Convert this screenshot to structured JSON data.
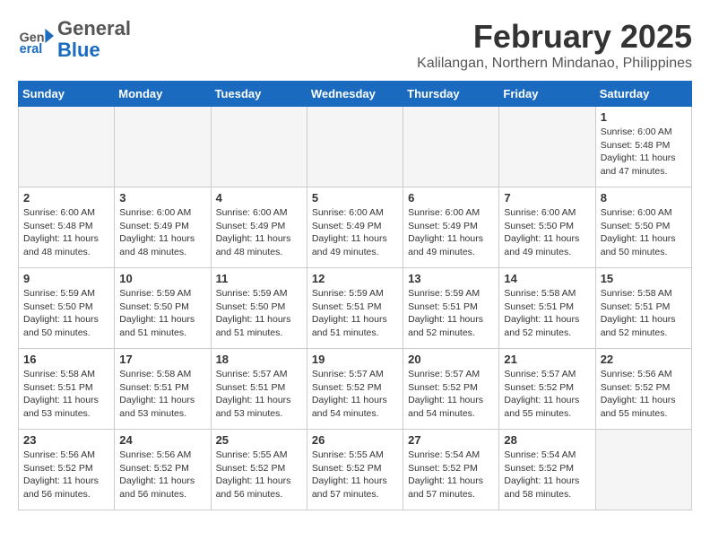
{
  "header": {
    "logo_general": "General",
    "logo_blue": "Blue",
    "month_title": "February 2025",
    "location": "Kalilangan, Northern Mindanao, Philippines"
  },
  "weekdays": [
    "Sunday",
    "Monday",
    "Tuesday",
    "Wednesday",
    "Thursday",
    "Friday",
    "Saturday"
  ],
  "weeks": [
    [
      {
        "day": "",
        "info": ""
      },
      {
        "day": "",
        "info": ""
      },
      {
        "day": "",
        "info": ""
      },
      {
        "day": "",
        "info": ""
      },
      {
        "day": "",
        "info": ""
      },
      {
        "day": "",
        "info": ""
      },
      {
        "day": "1",
        "info": "Sunrise: 6:00 AM\nSunset: 5:48 PM\nDaylight: 11 hours\nand 47 minutes."
      }
    ],
    [
      {
        "day": "2",
        "info": "Sunrise: 6:00 AM\nSunset: 5:48 PM\nDaylight: 11 hours\nand 48 minutes."
      },
      {
        "day": "3",
        "info": "Sunrise: 6:00 AM\nSunset: 5:49 PM\nDaylight: 11 hours\nand 48 minutes."
      },
      {
        "day": "4",
        "info": "Sunrise: 6:00 AM\nSunset: 5:49 PM\nDaylight: 11 hours\nand 48 minutes."
      },
      {
        "day": "5",
        "info": "Sunrise: 6:00 AM\nSunset: 5:49 PM\nDaylight: 11 hours\nand 49 minutes."
      },
      {
        "day": "6",
        "info": "Sunrise: 6:00 AM\nSunset: 5:49 PM\nDaylight: 11 hours\nand 49 minutes."
      },
      {
        "day": "7",
        "info": "Sunrise: 6:00 AM\nSunset: 5:50 PM\nDaylight: 11 hours\nand 49 minutes."
      },
      {
        "day": "8",
        "info": "Sunrise: 6:00 AM\nSunset: 5:50 PM\nDaylight: 11 hours\nand 50 minutes."
      }
    ],
    [
      {
        "day": "9",
        "info": "Sunrise: 5:59 AM\nSunset: 5:50 PM\nDaylight: 11 hours\nand 50 minutes."
      },
      {
        "day": "10",
        "info": "Sunrise: 5:59 AM\nSunset: 5:50 PM\nDaylight: 11 hours\nand 51 minutes."
      },
      {
        "day": "11",
        "info": "Sunrise: 5:59 AM\nSunset: 5:50 PM\nDaylight: 11 hours\nand 51 minutes."
      },
      {
        "day": "12",
        "info": "Sunrise: 5:59 AM\nSunset: 5:51 PM\nDaylight: 11 hours\nand 51 minutes."
      },
      {
        "day": "13",
        "info": "Sunrise: 5:59 AM\nSunset: 5:51 PM\nDaylight: 11 hours\nand 52 minutes."
      },
      {
        "day": "14",
        "info": "Sunrise: 5:58 AM\nSunset: 5:51 PM\nDaylight: 11 hours\nand 52 minutes."
      },
      {
        "day": "15",
        "info": "Sunrise: 5:58 AM\nSunset: 5:51 PM\nDaylight: 11 hours\nand 52 minutes."
      }
    ],
    [
      {
        "day": "16",
        "info": "Sunrise: 5:58 AM\nSunset: 5:51 PM\nDaylight: 11 hours\nand 53 minutes."
      },
      {
        "day": "17",
        "info": "Sunrise: 5:58 AM\nSunset: 5:51 PM\nDaylight: 11 hours\nand 53 minutes."
      },
      {
        "day": "18",
        "info": "Sunrise: 5:57 AM\nSunset: 5:51 PM\nDaylight: 11 hours\nand 53 minutes."
      },
      {
        "day": "19",
        "info": "Sunrise: 5:57 AM\nSunset: 5:52 PM\nDaylight: 11 hours\nand 54 minutes."
      },
      {
        "day": "20",
        "info": "Sunrise: 5:57 AM\nSunset: 5:52 PM\nDaylight: 11 hours\nand 54 minutes."
      },
      {
        "day": "21",
        "info": "Sunrise: 5:57 AM\nSunset: 5:52 PM\nDaylight: 11 hours\nand 55 minutes."
      },
      {
        "day": "22",
        "info": "Sunrise: 5:56 AM\nSunset: 5:52 PM\nDaylight: 11 hours\nand 55 minutes."
      }
    ],
    [
      {
        "day": "23",
        "info": "Sunrise: 5:56 AM\nSunset: 5:52 PM\nDaylight: 11 hours\nand 56 minutes."
      },
      {
        "day": "24",
        "info": "Sunrise: 5:56 AM\nSunset: 5:52 PM\nDaylight: 11 hours\nand 56 minutes."
      },
      {
        "day": "25",
        "info": "Sunrise: 5:55 AM\nSunset: 5:52 PM\nDaylight: 11 hours\nand 56 minutes."
      },
      {
        "day": "26",
        "info": "Sunrise: 5:55 AM\nSunset: 5:52 PM\nDaylight: 11 hours\nand 57 minutes."
      },
      {
        "day": "27",
        "info": "Sunrise: 5:54 AM\nSunset: 5:52 PM\nDaylight: 11 hours\nand 57 minutes."
      },
      {
        "day": "28",
        "info": "Sunrise: 5:54 AM\nSunset: 5:52 PM\nDaylight: 11 hours\nand 58 minutes."
      },
      {
        "day": "",
        "info": ""
      }
    ]
  ]
}
